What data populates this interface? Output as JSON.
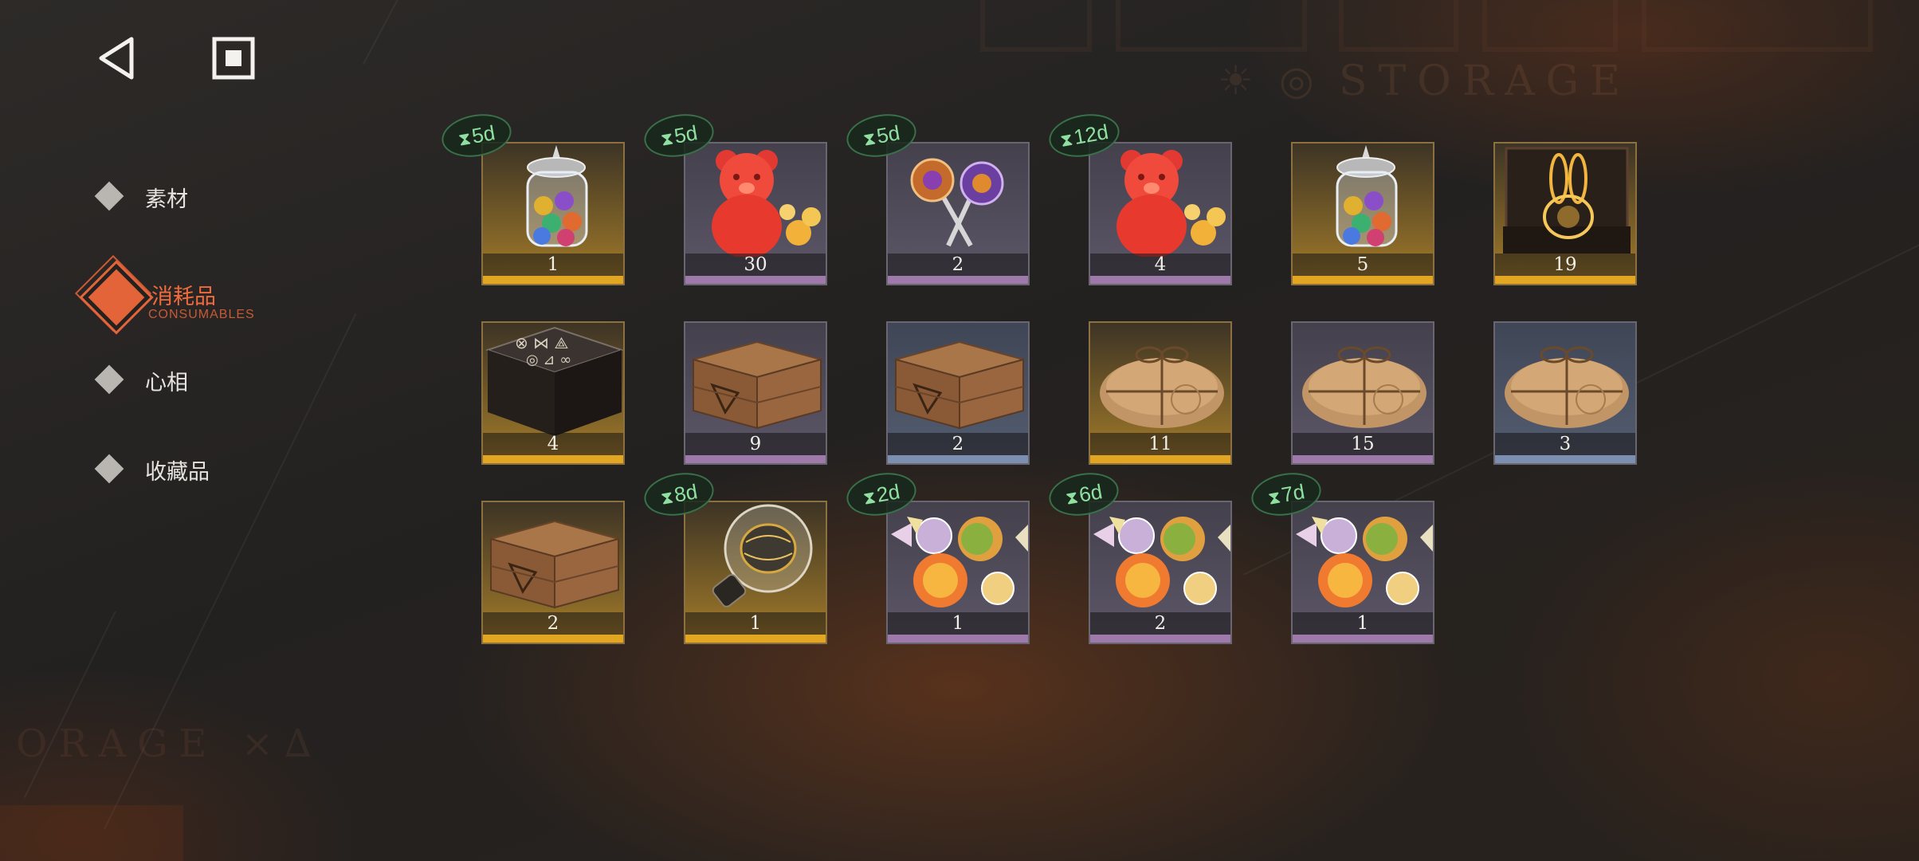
{
  "watermark": {
    "top": "STORAGE",
    "bottom": "ORAGE ×∆"
  },
  "nav": {
    "back_icon": "back-triangle-icon",
    "stop_icon": "stop-square-icon"
  },
  "categories": [
    {
      "label": "素材",
      "sub": "",
      "active": false
    },
    {
      "label": "消耗品",
      "sub": "CONSUMABLES",
      "active": true
    },
    {
      "label": "心相",
      "sub": "",
      "active": false
    },
    {
      "label": "收藏品",
      "sub": "",
      "active": false
    }
  ],
  "items": [
    {
      "name": "candy-jar",
      "count": "1",
      "rarity": "gold",
      "timer": "5d"
    },
    {
      "name": "gummy-bear",
      "count": "30",
      "rarity": "purple",
      "timer": "5d"
    },
    {
      "name": "lollipops",
      "count": "2",
      "rarity": "purple",
      "timer": "5d"
    },
    {
      "name": "gummy-bear",
      "count": "4",
      "rarity": "purple",
      "timer": "12d"
    },
    {
      "name": "candy-jar",
      "count": "5",
      "rarity": "gold",
      "timer": ""
    },
    {
      "name": "golden-rabbit-box",
      "count": "19",
      "rarity": "gold",
      "timer": ""
    },
    {
      "name": "rune-crate",
      "count": "4",
      "rarity": "gold",
      "timer": ""
    },
    {
      "name": "wooden-crate",
      "count": "9",
      "rarity": "purple",
      "timer": ""
    },
    {
      "name": "wooden-crate",
      "count": "2",
      "rarity": "blue",
      "timer": ""
    },
    {
      "name": "paper-parcel",
      "count": "11",
      "rarity": "gold",
      "timer": ""
    },
    {
      "name": "paper-parcel",
      "count": "15",
      "rarity": "purple",
      "timer": ""
    },
    {
      "name": "paper-parcel",
      "count": "3",
      "rarity": "blue",
      "timer": ""
    },
    {
      "name": "wooden-crate",
      "count": "2",
      "rarity": "gold",
      "timer": ""
    },
    {
      "name": "glass-bulb",
      "count": "1",
      "rarity": "gold",
      "timer": "8d"
    },
    {
      "name": "wrapped-candies",
      "count": "1",
      "rarity": "purple",
      "timer": "2d"
    },
    {
      "name": "wrapped-candies",
      "count": "2",
      "rarity": "purple",
      "timer": "6d"
    },
    {
      "name": "wrapped-candies",
      "count": "1",
      "rarity": "purple",
      "timer": "7d"
    }
  ],
  "colors": {
    "accent": "#e4643a",
    "gold": "#e3a623",
    "purple": "#9e7aab",
    "blue": "#7d8fb0",
    "timer_green": "#8fe0a0"
  }
}
